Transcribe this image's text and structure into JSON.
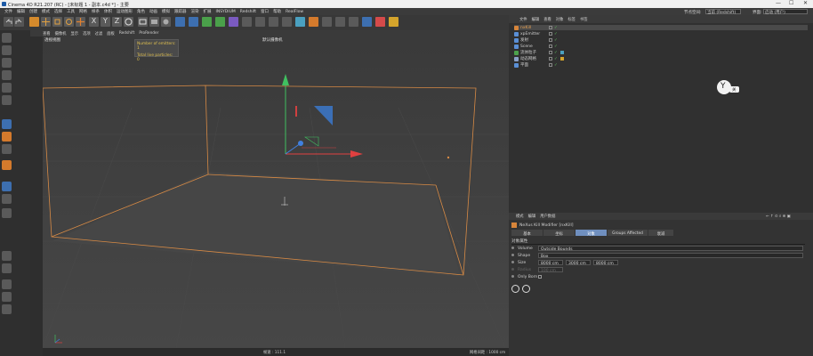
{
  "app": {
    "title": "Cinema 4D R21.207 (RC) - [未标题 1 - 副本.c4d *] - 主要",
    "window_controls": [
      "—",
      "☐",
      "✕"
    ]
  },
  "menubar": {
    "items": [
      "文件",
      "编辑",
      "创建",
      "模式",
      "选择",
      "工具",
      "网格",
      "样条",
      "体积",
      "运动图形",
      "角色",
      "动画",
      "模拟",
      "跟踪器",
      "渲染",
      "扩展",
      "INSYDIUM",
      "Redshift",
      "窗口",
      "帮助",
      "RealFlow"
    ],
    "right": {
      "interface_label": "界面:",
      "interface_value": "启动 (用户)",
      "node_label": "节点空间:",
      "node_value": "当前 (Redshift)"
    }
  },
  "toolbar": {
    "icons": [
      "undo-icon",
      "redo-icon",
      "live-select-icon",
      "move-icon",
      "scale-icon",
      "rotate-icon",
      "cursor-icon",
      "x-axis-icon",
      "y-axis-icon",
      "z-axis-icon",
      "coord-icon",
      "render-view-icon",
      "render-region-icon",
      "render-settings-icon",
      "cube-icon",
      "pen-icon",
      "subdivision-icon",
      "array-icon",
      "deformer-icon",
      "camera-icon",
      "light-icon",
      "magnet-icon",
      "scene-icon",
      "paint-icon",
      "brush-icon",
      "grid-icon",
      "render-icon",
      "light-bulb-icon",
      "python-icon",
      "script-icon",
      "settings-icon"
    ],
    "axis_labels": [
      "X",
      "Y",
      "Z"
    ]
  },
  "viewport": {
    "menu": [
      "查看",
      "摄像机",
      "显示",
      "选项",
      "过滤",
      "面板",
      "Redshift",
      "ProRender"
    ],
    "label": "透视视图",
    "camera": "默认摄像机",
    "hud": {
      "emitters": "Number of emitters: 1",
      "particles": "Total live particles: 0"
    },
    "status_left": "帧速 : 111.1",
    "status_right": "网格间距 : 1000 cm"
  },
  "object_manager": {
    "menu": [
      "文件",
      "编辑",
      "查看",
      "对象",
      "标签",
      "书签"
    ],
    "objects": [
      {
        "name": "nxKill",
        "color": "#d7853a"
      },
      {
        "name": "xpEmitter",
        "color": "#5a8fd6"
      },
      {
        "name": "发射",
        "color": "#5a8fd6"
      },
      {
        "name": "Scene",
        "color": "#5a8fd6"
      },
      {
        "name": "流体粒子",
        "color": "#4ca14c"
      },
      {
        "name": "动态网格",
        "color": "#8aa0c8"
      },
      {
        "name": "平面",
        "color": "#5a8fd6"
      }
    ],
    "badge": "关"
  },
  "attribute_manager": {
    "menu": [
      "模式",
      "编辑",
      "用户数据"
    ],
    "object_title": "NeXus Kill Modifier [nxKill]",
    "tabs": [
      "基本",
      "坐标",
      "对象",
      "Groups Affected",
      "衰减"
    ],
    "active_tab": "对象",
    "section": "对象属性",
    "properties": {
      "volume_label": "Volume",
      "volume_value": "Outside Bounds",
      "shape_label": "Shape",
      "shape_value": "Box",
      "size_label": "Size",
      "size_x": "8000 cm",
      "size_y": "3000 cm",
      "size_z": "8000 cm",
      "radius_label": "Radius",
      "radius_value": "100 cm",
      "only_born_label": "Only Born"
    }
  },
  "colors": {
    "accent_orange": "#d78a45",
    "active_tab": "#6f8fbf",
    "hud_text": "#e0c050",
    "axis_x": "#e04040",
    "axis_y": "#40c060",
    "axis_z": "#4080e0"
  }
}
